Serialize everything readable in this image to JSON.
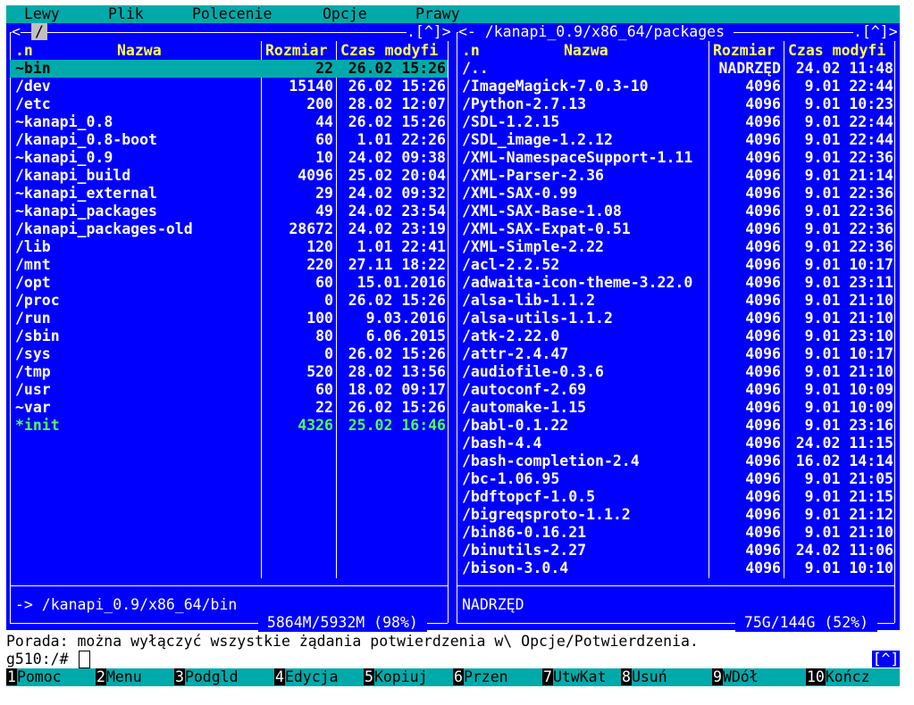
{
  "menubar": {
    "items": [
      "Lewy",
      "Plik",
      "Polecenie",
      "Opcje",
      "Prawy"
    ]
  },
  "left_panel": {
    "title_left": "<",
    "path": "/",
    "title_right": ".[^]>",
    "headers": {
      "n": ".n",
      "name": "Nazwa",
      "size": "Rozmiar",
      "time": "Czas modyfi"
    },
    "rows": [
      {
        "name": "~bin",
        "size": "22",
        "time": "26.02 15:26",
        "selected": true
      },
      {
        "name": "/dev",
        "size": "15140",
        "time": "26.02 15:26"
      },
      {
        "name": "/etc",
        "size": "200",
        "time": "28.02 12:07"
      },
      {
        "name": "~kanapi_0.8",
        "size": "44",
        "time": "26.02 15:26"
      },
      {
        "name": "/kanapi_0.8-boot",
        "size": "60",
        "time": " 1.01 22:26"
      },
      {
        "name": "~kanapi_0.9",
        "size": "10",
        "time": "24.02 09:38"
      },
      {
        "name": "/kanapi_build",
        "size": "4096",
        "time": "25.02 20:04"
      },
      {
        "name": "~kanapi_external",
        "size": "29",
        "time": "24.02 09:32"
      },
      {
        "name": "~kanapi_packages",
        "size": "49",
        "time": "24.02 23:54"
      },
      {
        "name": "/kanapi_packages-old",
        "size": "28672",
        "time": "24.02 23:19"
      },
      {
        "name": "/lib",
        "size": "120",
        "time": " 1.01 22:41"
      },
      {
        "name": "/mnt",
        "size": "220",
        "time": "27.11 18:22"
      },
      {
        "name": "/opt",
        "size": "60",
        "time": "15.01.2016"
      },
      {
        "name": "/proc",
        "size": "0",
        "time": "26.02 15:26"
      },
      {
        "name": "/run",
        "size": "100",
        "time": " 9.03.2016"
      },
      {
        "name": "/sbin",
        "size": "80",
        "time": " 6.06.2015"
      },
      {
        "name": "/sys",
        "size": "0",
        "time": "26.02 15:26"
      },
      {
        "name": "/tmp",
        "size": "520",
        "time": "28.02 13:56"
      },
      {
        "name": "/usr",
        "size": "60",
        "time": "18.02 09:17"
      },
      {
        "name": "~var",
        "size": "22",
        "time": "26.02 15:26"
      },
      {
        "name": "*init",
        "size": "4326",
        "time": "25.02 16:46",
        "exec": true
      }
    ],
    "status": "-> /kanapi_0.9/x86_64/bin",
    "disk": " 5864M/5932M (98%) "
  },
  "right_panel": {
    "title_left": "<- /kanapi_0.9/x86_64/packages ",
    "title_right": ".[^]>",
    "headers": {
      "n": ".n",
      "name": "Nazwa",
      "size": "Rozmiar",
      "time": "Czas modyfi"
    },
    "rows": [
      {
        "name": "/..",
        "size": "NADRZĘD",
        "time": "24.02 11:48"
      },
      {
        "name": "/ImageMagick-7.0.3-10",
        "size": "4096",
        "time": " 9.01 22:44"
      },
      {
        "name": "/Python-2.7.13",
        "size": "4096",
        "time": " 9.01 10:23"
      },
      {
        "name": "/SDL-1.2.15",
        "size": "4096",
        "time": " 9.01 22:44"
      },
      {
        "name": "/SDL_image-1.2.12",
        "size": "4096",
        "time": " 9.01 22:44"
      },
      {
        "name": "/XML-NamespaceSupport-1.11",
        "size": "4096",
        "time": " 9.01 22:36"
      },
      {
        "name": "/XML-Parser-2.36",
        "size": "4096",
        "time": " 9.01 21:14"
      },
      {
        "name": "/XML-SAX-0.99",
        "size": "4096",
        "time": " 9.01 22:36"
      },
      {
        "name": "/XML-SAX-Base-1.08",
        "size": "4096",
        "time": " 9.01 22:36"
      },
      {
        "name": "/XML-SAX-Expat-0.51",
        "size": "4096",
        "time": " 9.01 22:36"
      },
      {
        "name": "/XML-Simple-2.22",
        "size": "4096",
        "time": " 9.01 22:36"
      },
      {
        "name": "/acl-2.2.52",
        "size": "4096",
        "time": " 9.01 10:17"
      },
      {
        "name": "/adwaita-icon-theme-3.22.0",
        "size": "4096",
        "time": " 9.01 23:11"
      },
      {
        "name": "/alsa-lib-1.1.2",
        "size": "4096",
        "time": " 9.01 21:10"
      },
      {
        "name": "/alsa-utils-1.1.2",
        "size": "4096",
        "time": " 9.01 21:10"
      },
      {
        "name": "/atk-2.22.0",
        "size": "4096",
        "time": " 9.01 23:10"
      },
      {
        "name": "/attr-2.4.47",
        "size": "4096",
        "time": " 9.01 10:17"
      },
      {
        "name": "/audiofile-0.3.6",
        "size": "4096",
        "time": " 9.01 21:10"
      },
      {
        "name": "/autoconf-2.69",
        "size": "4096",
        "time": " 9.01 10:09"
      },
      {
        "name": "/automake-1.15",
        "size": "4096",
        "time": " 9.01 10:09"
      },
      {
        "name": "/babl-0.1.22",
        "size": "4096",
        "time": " 9.01 23:16"
      },
      {
        "name": "/bash-4.4",
        "size": "4096",
        "time": "24.02 11:15"
      },
      {
        "name": "/bash-completion-2.4",
        "size": "4096",
        "time": "16.02 14:14"
      },
      {
        "name": "/bc-1.06.95",
        "size": "4096",
        "time": " 9.01 21:05"
      },
      {
        "name": "/bdftopcf-1.0.5",
        "size": "4096",
        "time": " 9.01 21:15"
      },
      {
        "name": "/bigreqsproto-1.1.2",
        "size": "4096",
        "time": " 9.01 21:12"
      },
      {
        "name": "/bin86-0.16.21",
        "size": "4096",
        "time": " 9.01 21:10"
      },
      {
        "name": "/binutils-2.27",
        "size": "4096",
        "time": "24.02 11:06"
      },
      {
        "name": "/bison-3.0.4",
        "size": "4096",
        "time": " 9.01 10:10"
      }
    ],
    "status": "NADRZĘD",
    "disk": " 75G/144G (52%) "
  },
  "hint": "Porada: można wyłączyć wszystkie żądania potwierdzenia w\\ Opcje/Potwierdzenia.",
  "prompt": "g510:/# ",
  "scroll_indicator": "[^]",
  "fkeys": [
    {
      "num": "1",
      "label": "Pomoc"
    },
    {
      "num": "2",
      "label": "Menu"
    },
    {
      "num": "3",
      "label": "Podgld"
    },
    {
      "num": "4",
      "label": "Edycja"
    },
    {
      "num": "5",
      "label": "Kopiuj"
    },
    {
      "num": "6",
      "label": "Przen"
    },
    {
      "num": "7",
      "label": "UtwKat"
    },
    {
      "num": "8",
      "label": "Usuń"
    },
    {
      "num": "9",
      "label": "WDół"
    },
    {
      "num": "10",
      "label": "Kończ"
    }
  ],
  "colors": {
    "panel_bg": "#0000ff",
    "accent_cyan": "#00aaaa",
    "header_yellow": "#ffff55",
    "exec_green": "#55ff55"
  }
}
